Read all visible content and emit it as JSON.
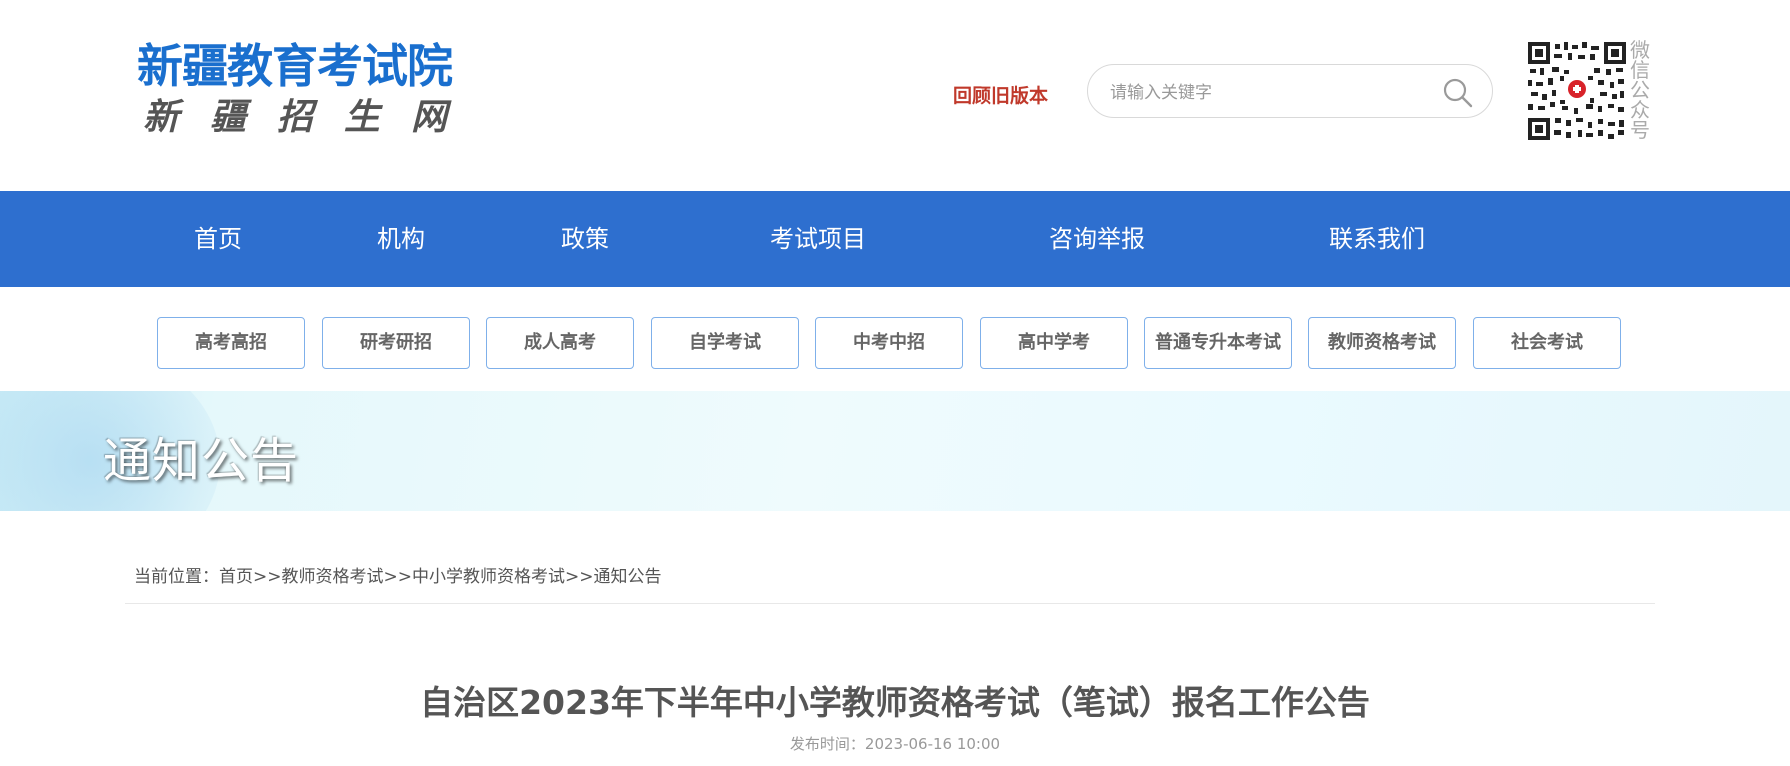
{
  "header": {
    "logo_line1": "新疆教育考试院",
    "logo_line2": "新疆招生网",
    "old_version_link": "回顾旧版本",
    "search_placeholder": "请输入关键字",
    "qr_label": "微信公众号"
  },
  "nav": {
    "items": [
      {
        "label": "首页"
      },
      {
        "label": "机构"
      },
      {
        "label": "政策"
      },
      {
        "label": "考试项目"
      },
      {
        "label": "咨询举报"
      },
      {
        "label": "联系我们"
      }
    ]
  },
  "subnav": {
    "items": [
      {
        "label": "高考高招"
      },
      {
        "label": "研考研招"
      },
      {
        "label": "成人高考"
      },
      {
        "label": "自学考试"
      },
      {
        "label": "中考中招"
      },
      {
        "label": "高中学考"
      },
      {
        "label": "普通专升本考试"
      },
      {
        "label": "教师资格考试"
      },
      {
        "label": "社会考试"
      }
    ]
  },
  "banner": {
    "title": "通知公告"
  },
  "breadcrumb": {
    "prefix": "当前位置：",
    "items": [
      "首页",
      "教师资格考试",
      "中小学教师资格考试",
      "通知公告"
    ],
    "separator": ">>"
  },
  "article": {
    "title": "自治区2023年下半年中小学教师资格考试（笔试）报名工作公告",
    "publish_time": "发布时间：2023-06-16 10:00"
  },
  "colors": {
    "nav_bg": "#2e6fcf",
    "logo_blue": "#1a6fce",
    "old_version_red": "#c0392b",
    "subnav_border": "#7fb0ea"
  }
}
